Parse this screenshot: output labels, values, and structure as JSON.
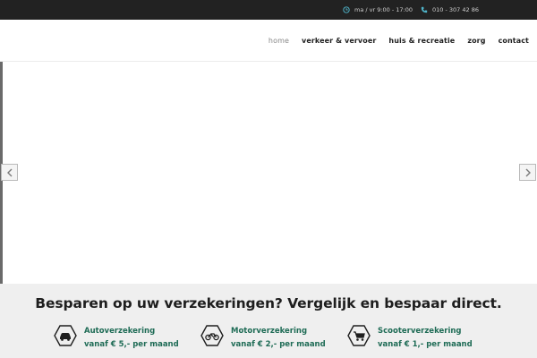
{
  "topbar": {
    "hours": "ma / vr 9:00 - 17:00",
    "phone": "010 - 307 42 86",
    "hours_icon": "clock-icon",
    "phone_icon": "phone-icon"
  },
  "nav": {
    "items": [
      {
        "label": "home",
        "active": true
      },
      {
        "label": "verkeer & vervoer"
      },
      {
        "label": "huis & recreatie"
      },
      {
        "label": "zorg"
      },
      {
        "label": "contact"
      }
    ]
  },
  "slider": {
    "prev_icon": "chevron-left-icon",
    "next_icon": "chevron-right-icon"
  },
  "promo": {
    "heading": "Besparen op uw verzekeringen? Vergelijk en bespaar direct.",
    "offers": [
      {
        "name": "Autoverzekering",
        "price": "vanaf € 5,- per maand",
        "icon": "car-icon"
      },
      {
        "name": "Motorverzekering",
        "price": "vanaf € 2,- per maand",
        "icon": "motorcycle-icon"
      },
      {
        "name": "Scooterverzekering",
        "price": "vanaf € 1,- per maand",
        "icon": "scooter-icon"
      }
    ]
  },
  "colors": {
    "topbar_bg": "#222222",
    "accent_icon": "#4fb3c8",
    "offer_text": "#1e6b55",
    "band_bg": "#efefef"
  }
}
